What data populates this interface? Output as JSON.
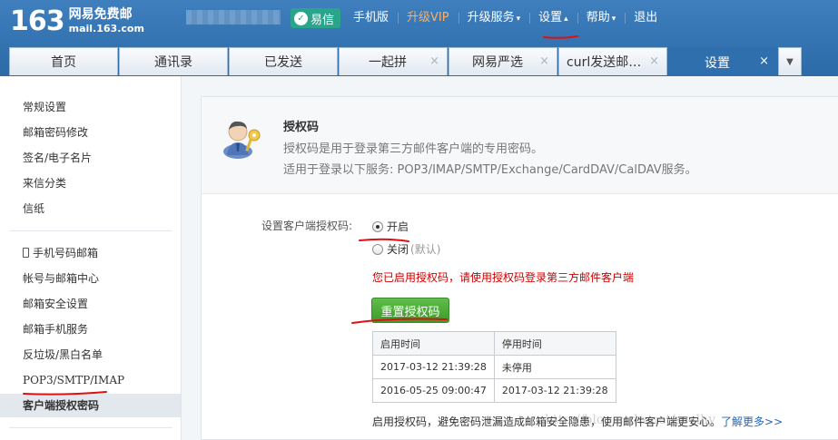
{
  "header": {
    "logo_number": "163",
    "logo_line1": "网易免费邮",
    "logo_line2": "mail.163.com",
    "nav": {
      "yixin": "易信",
      "mobile": "手机版",
      "vip": "升级VIP",
      "upgrade": "升级服务",
      "settings": "设置",
      "help": "帮助",
      "logout": "退出"
    },
    "colors": {
      "bar": "#2c6aa8",
      "vip": "#f6b06b",
      "yixin": "#2aa58c"
    }
  },
  "tabs": [
    {
      "label": "首页"
    },
    {
      "label": "通讯录"
    },
    {
      "label": "已发送"
    },
    {
      "label": "一起拼",
      "close": "×"
    },
    {
      "label": "网易严选",
      "close": "×"
    },
    {
      "label": "curl发送邮件…",
      "close": "×"
    },
    {
      "label": "设置",
      "close": "×"
    }
  ],
  "sidebar": {
    "group1": [
      "常规设置",
      "邮箱密码修改",
      "签名/电子名片",
      "来信分类",
      "信纸"
    ],
    "group2": [
      "手机号码邮箱",
      "帐号与邮箱中心",
      "邮箱安全设置",
      "邮箱手机服务",
      "反垃圾/黑白名单",
      "POP3/SMTP/IMAP",
      "客户端授权密码"
    ]
  },
  "main": {
    "title": "授权码",
    "desc1": "授权码是用于登录第三方邮件客户端的专用密码。",
    "desc2": "适用于登录以下服务: POP3/IMAP/SMTP/Exchange/CardDAV/CalDAV服务。",
    "form_label": "设置客户端授权码:",
    "option_on": "开启",
    "option_off": "关闭",
    "option_off_note": "(默认)",
    "notice": "您已启用授权码，请使用授权码登录第三方邮件客户端",
    "reset_button": "重置授权码",
    "table": {
      "headers": [
        "启用时间",
        "停用时间"
      ],
      "rows": [
        [
          "2017-03-12 21:39:28",
          "未停用"
        ],
        [
          "2016-05-25 09:00:47",
          "2017-03-12 21:39:28"
        ]
      ]
    },
    "footer_text": "启用授权码，避免密码泄漏造成邮箱安全隐患，使用邮件客户端更安心。",
    "footer_link": "了解更多>>"
  },
  "watermark": "http://blog.csdn.net/scylhy"
}
